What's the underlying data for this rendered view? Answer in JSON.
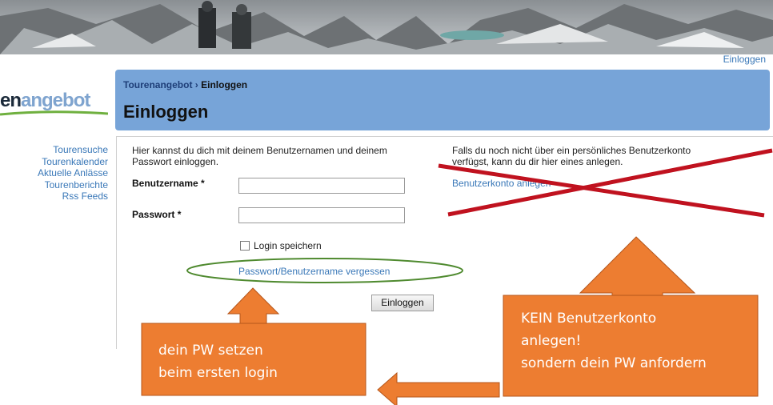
{
  "header_link": "Einloggen",
  "logo": {
    "part1": "en",
    "part2": "angebot"
  },
  "sidebar": {
    "items": [
      {
        "label": "Tourensuche"
      },
      {
        "label": "Tourenkalender"
      },
      {
        "label": "Aktuelle Anlässe"
      },
      {
        "label": "Tourenberichte"
      },
      {
        "label": "Rss Feeds"
      }
    ]
  },
  "breadcrumb": {
    "parent": "Tourenangebot",
    "separator": "›",
    "current": "Einloggen"
  },
  "page_title": "Einloggen",
  "login_form": {
    "intro_line1": "Hier kannst du dich mit deinem Benutzernamen und deinem",
    "intro_line2": "Passwort einloggen.",
    "username_label": "Benutzername *",
    "username_value": "",
    "password_label": "Passwort *",
    "password_value": "",
    "remember_label": "Login speichern",
    "forgot_link": "Passwort/Benutzername vergessen",
    "submit_label": "Einloggen"
  },
  "register": {
    "info_line1": "Falls du noch nicht über ein persönliches Benutzerkonto",
    "info_line2": "verfügst, kann du dir hier eines anlegen.",
    "link": "Benutzerkonto anlegen"
  },
  "annotations": {
    "left_box": {
      "line1": "dein PW setzen",
      "line2": "beim ersten login"
    },
    "right_box": {
      "line1": "KEIN Benutzerkonto",
      "line2": "anlegen!",
      "line3": "sondern dein PW anfordern"
    },
    "accent_color": "#ed7d31",
    "cross_color": "#c0121f",
    "ellipse_color": "#4f8a2f"
  }
}
